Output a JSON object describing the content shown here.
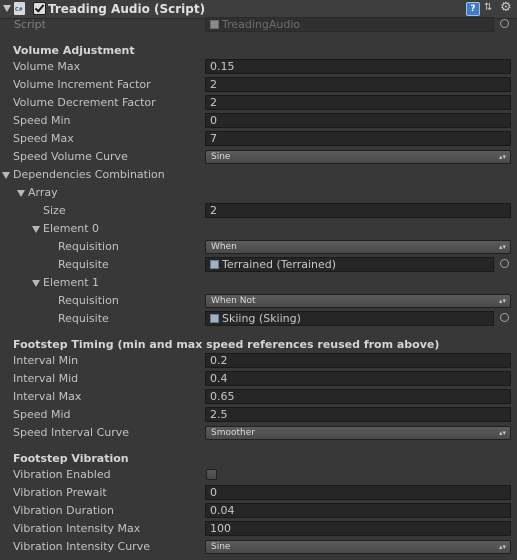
{
  "component": {
    "title": "Treading Audio (Script)",
    "enabled": true,
    "script_label": "Script",
    "script_value": "TreadingAudio"
  },
  "volume": {
    "header": "Volume Adjustment",
    "volume_max_label": "Volume Max",
    "volume_max": "0.15",
    "inc_label": "Volume Increment Factor",
    "inc": "2",
    "dec_label": "Volume Decrement Factor",
    "dec": "2",
    "speed_min_label": "Speed Min",
    "speed_min": "0",
    "speed_max_label": "Speed Max",
    "speed_max": "7",
    "curve_label": "Speed Volume Curve",
    "curve": "Sine"
  },
  "deps": {
    "label": "Dependencies Combination",
    "array_label": "Array",
    "size_label": "Size",
    "size": "2",
    "elements": [
      {
        "label": "Element 0",
        "requisition_label": "Requisition",
        "requisition": "When",
        "requisite_label": "Requisite",
        "requisite": "Terrained (Terrained)"
      },
      {
        "label": "Element 1",
        "requisition_label": "Requisition",
        "requisition": "When Not",
        "requisite_label": "Requisite",
        "requisite": "Skiing (Skiing)"
      }
    ]
  },
  "footstep": {
    "header": "Footstep Timing (min and max speed references reused from above)",
    "interval_min_label": "Interval Min",
    "interval_min": "0.2",
    "interval_mid_label": "Interval Mid",
    "interval_mid": "0.4",
    "interval_max_label": "Interval Max",
    "interval_max": "0.65",
    "speed_mid_label": "Speed Mid",
    "speed_mid": "2.5",
    "curve_label": "Speed Interval Curve",
    "curve": "Smoother"
  },
  "vibration": {
    "header": "Footstep Vibration",
    "enabled_label": "Vibration Enabled",
    "enabled": false,
    "prewait_label": "Vibration Prewait",
    "prewait": "0",
    "duration_label": "Vibration Duration",
    "duration": "0.04",
    "intensity_max_label": "Vibration Intensity Max",
    "intensity_max": "100",
    "curve_label": "Vibration Intensity Curve",
    "curve": "Sine"
  },
  "icons": {
    "foldout": "triangle-down-icon",
    "script": "csharp-script-icon",
    "help": "help-icon",
    "preset": "preset-icon",
    "settings": "gear-icon",
    "object_picker": "object-picker-icon"
  },
  "colors": {
    "background": "#383838",
    "field_bg": "#262626",
    "text": "#c3c3c3",
    "help_blue": "#3e7ec9"
  }
}
